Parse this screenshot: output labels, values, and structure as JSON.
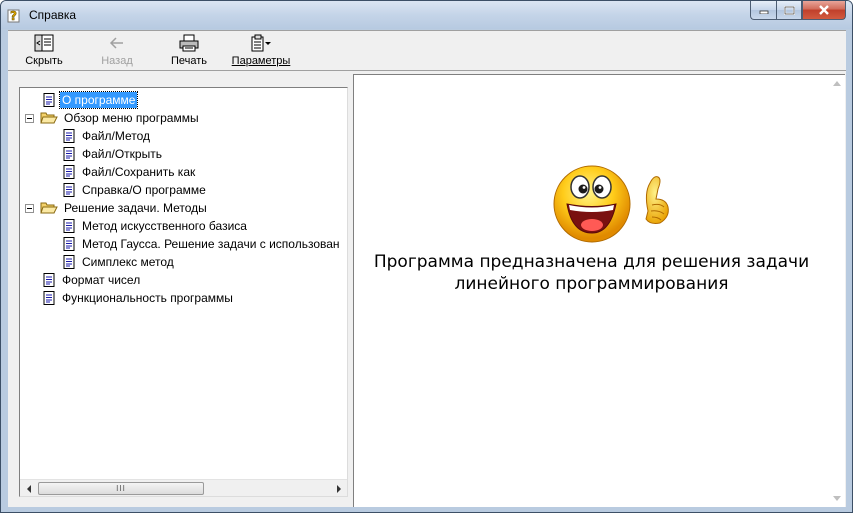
{
  "window": {
    "title": "Справка",
    "icon": "help-icon"
  },
  "caption_buttons": [
    {
      "name": "minimize",
      "icon": "minimize-icon"
    },
    {
      "name": "maximize",
      "icon": "maximize-icon"
    },
    {
      "name": "close",
      "icon": "close-icon"
    }
  ],
  "toolbar": {
    "hide_label": "Скрыть",
    "back_label": "Назад",
    "print_label": "Печать",
    "options_label": "Параметры"
  },
  "tree": {
    "items": [
      {
        "label": "О программе",
        "type": "page",
        "selected": true
      },
      {
        "label": "Обзор меню программы",
        "type": "folder",
        "expanded": true
      },
      {
        "label": "Файл/Метод",
        "type": "page"
      },
      {
        "label": "Файл/Открыть",
        "type": "page"
      },
      {
        "label": "Файл/Сохранить как",
        "type": "page"
      },
      {
        "label": "Справка/О программе",
        "type": "page"
      },
      {
        "label": "Решение задачи. Методы",
        "type": "folder",
        "expanded": true
      },
      {
        "label": "Метод искусственного базиса",
        "type": "page"
      },
      {
        "label": "Метод Гаусса. Решение задачи с использован",
        "type": "page"
      },
      {
        "label": "Симплекс метод",
        "type": "page"
      },
      {
        "label": "Формат чисел",
        "type": "page"
      },
      {
        "label": "Функциональность программы",
        "type": "page"
      }
    ],
    "scroll_thumb_glyph": "III"
  },
  "content": {
    "image": "smiley-thumbs-up",
    "line1": "Программа предназначена для решения задачи",
    "line2": "линейного программирования"
  },
  "colors": {
    "selection": "#3399ff",
    "close_button": "#c0402b",
    "frame": "#b9cbe0"
  }
}
